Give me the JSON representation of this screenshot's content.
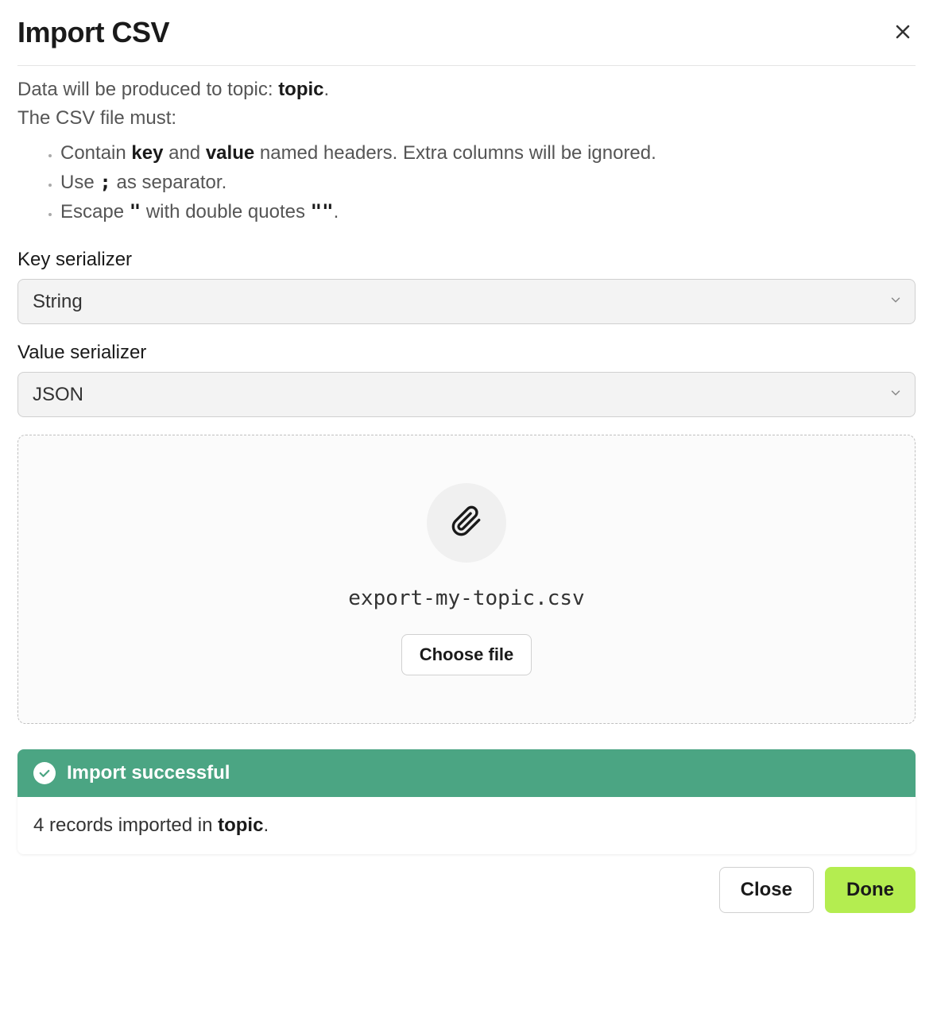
{
  "header": {
    "title": "Import CSV"
  },
  "intro": {
    "line1_prefix": "Data will be produced to topic: ",
    "line1_topic": "topic",
    "line1_suffix": ".",
    "line2": "The CSV file must:"
  },
  "requirements": {
    "item1_prefix": "Contain ",
    "item1_key": "key",
    "item1_mid": " and ",
    "item1_value": "value",
    "item1_suffix": " named headers. Extra columns will be ignored.",
    "item2_prefix": "Use ",
    "item2_code": ";",
    "item2_suffix": " as separator.",
    "item3_prefix": "Escape ",
    "item3_code1": "\"",
    "item3_mid": " with double quotes ",
    "item3_code2": "\"\"",
    "item3_suffix": "."
  },
  "fields": {
    "key_serializer": {
      "label": "Key serializer",
      "value": "String"
    },
    "value_serializer": {
      "label": "Value serializer",
      "value": "JSON"
    }
  },
  "dropzone": {
    "filename": "export-my-topic.csv",
    "choose_file_label": "Choose file"
  },
  "alert": {
    "title": "Import successful",
    "body_prefix": "4 records imported in ",
    "body_topic": "topic",
    "body_suffix": "."
  },
  "footer": {
    "close_label": "Close",
    "done_label": "Done"
  }
}
